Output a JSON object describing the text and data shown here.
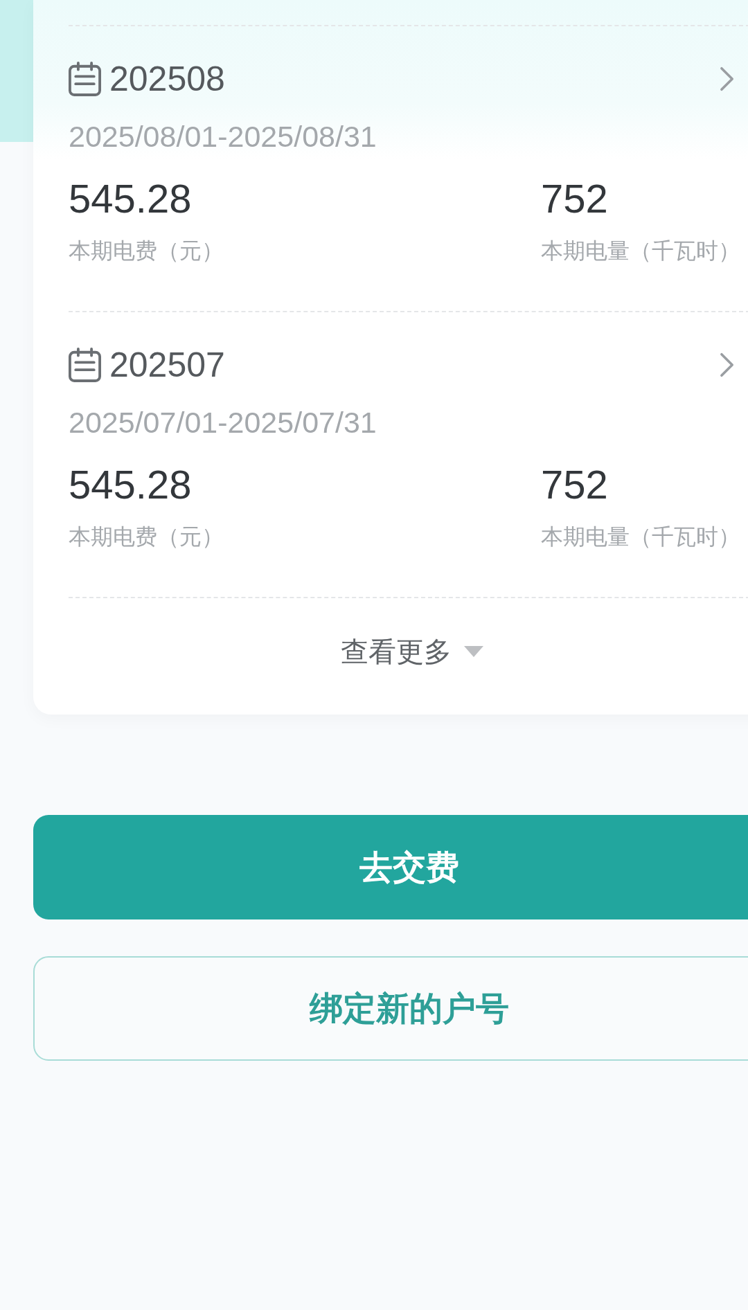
{
  "bills": [
    {
      "period": "202508",
      "date_range": "2025/08/01-2025/08/31",
      "fee": "545.28",
      "fee_label": "本期电费（元）",
      "usage": "752",
      "usage_label": "本期电量（千瓦时）"
    },
    {
      "period": "202507",
      "date_range": "2025/07/01-2025/07/31",
      "fee": "545.28",
      "fee_label": "本期电费（元）",
      "usage": "752",
      "usage_label": "本期电量（千瓦时）"
    }
  ],
  "more_link": {
    "label": "查看更多"
  },
  "buttons": [
    {
      "label": "去交费",
      "kind": "primary"
    },
    {
      "label": "绑定新的户号",
      "kind": "outline"
    }
  ]
}
